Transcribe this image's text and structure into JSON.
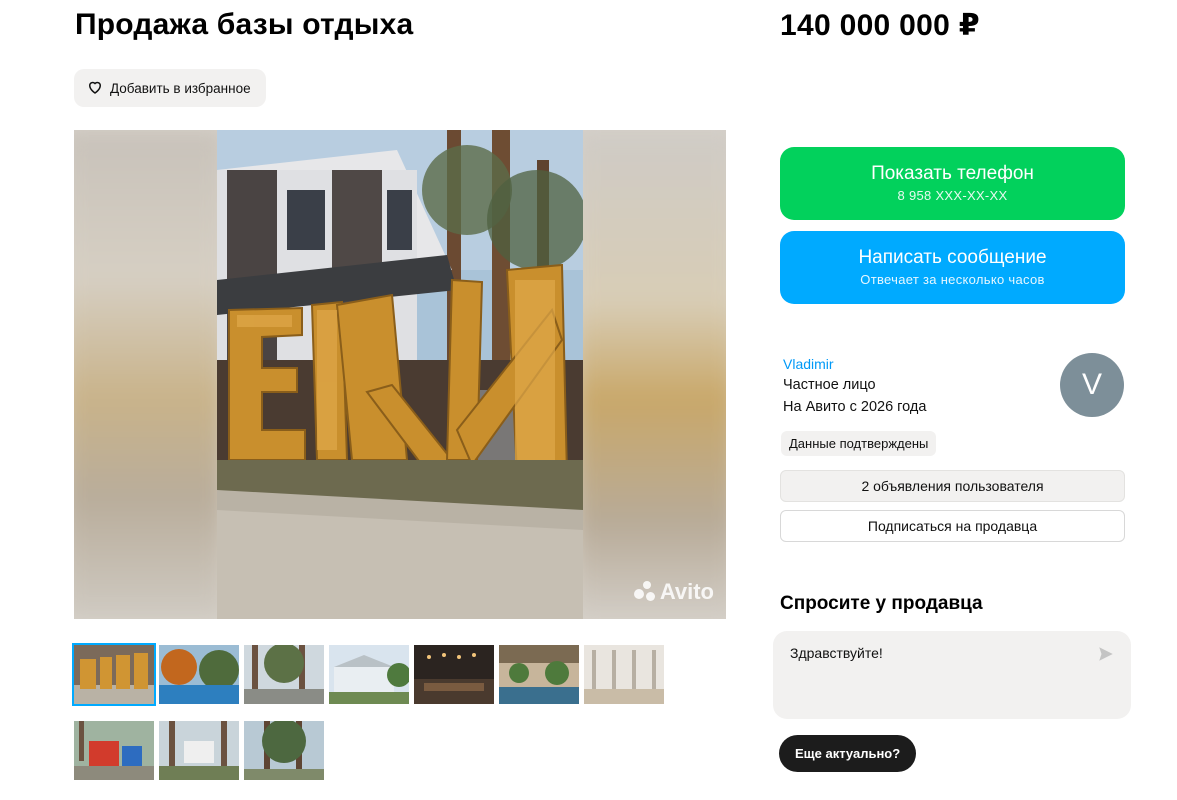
{
  "listing": {
    "title": "Продажа базы отдыха",
    "price": "140 000 000 ₽",
    "favorite_label": "Добавить в избранное",
    "watermark": "Avito",
    "photo_count": 10,
    "active_photo_index": 0
  },
  "contact": {
    "call_label": "Показать телефон",
    "call_sub": "8 958 XXX-XX-XX",
    "message_label": "Написать сообщение",
    "message_sub": "Отвечает за несколько часов",
    "call_color": "#02d15c",
    "message_color": "#00aaff"
  },
  "seller": {
    "name": "Vladimir",
    "type": "Частное лицо",
    "since": "На Авито с 2026 года",
    "avatar_letter": "V",
    "verified_label": "Данные подтверждены",
    "ads_button": "2 объявления пользователя",
    "subscribe_button": "Подписаться на продавца"
  },
  "ask": {
    "title": "Спросите у продавца",
    "input_value": "Здравствуйте!",
    "quick_reply": "Еще актуально?"
  },
  "icons": {
    "favorite": "heart-icon",
    "send": "send-icon"
  }
}
